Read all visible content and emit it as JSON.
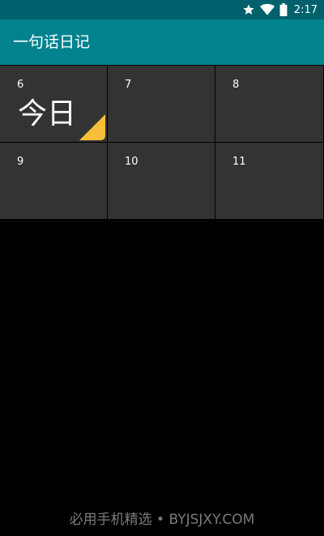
{
  "status_bar": {
    "time": "2:17",
    "icons": [
      "star-icon",
      "wifi-icon",
      "battery-icon"
    ]
  },
  "app_bar": {
    "title": "一句话日记"
  },
  "calendar": {
    "days": [
      {
        "number": "6",
        "label": "今日",
        "today": true
      },
      {
        "number": "7",
        "label": "",
        "today": false
      },
      {
        "number": "8",
        "label": "",
        "today": false
      },
      {
        "number": "9",
        "label": "",
        "today": false
      },
      {
        "number": "10",
        "label": "",
        "today": false
      },
      {
        "number": "11",
        "label": "",
        "today": false
      }
    ]
  },
  "watermark": "必用手机精选 • BYJSJXY.COM",
  "colors": {
    "status_bar": "#00616c",
    "app_bar": "#00838f",
    "cell_bg": "#333333",
    "today_marker": "#f6bf3a",
    "background": "#000000"
  }
}
